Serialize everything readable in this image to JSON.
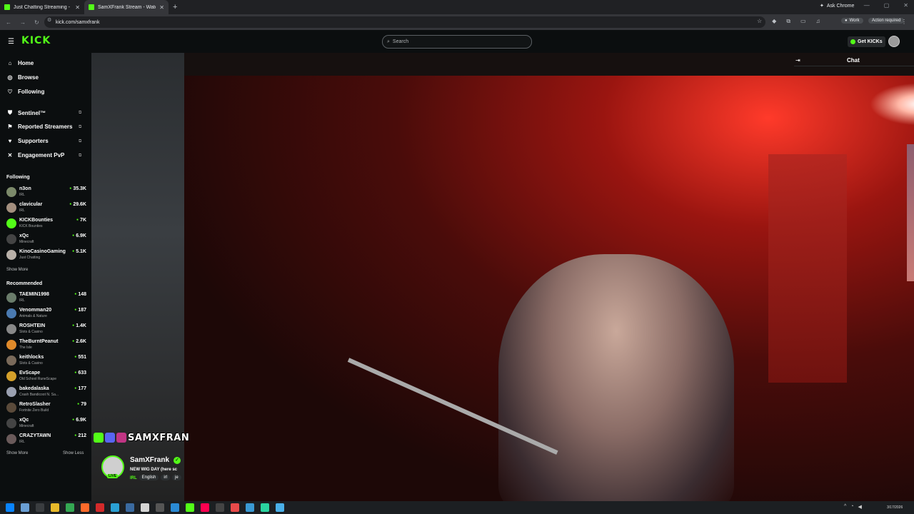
{
  "browser": {
    "tabs": [
      {
        "title": "Just Chatting Streaming - Live"
      },
      {
        "title": "SamXFrank Stream - Watch Liv"
      }
    ],
    "new_tab": "+",
    "ask_chrome": "Ask Chrome",
    "url": "kick.com/samxfrank",
    "profile_badge": "Work",
    "action_required": "Action required"
  },
  "kick": {
    "logo": "KICK",
    "search_placeholder": "Search",
    "get_kicks": "Get KICKs",
    "brand_color": "#53fc18"
  },
  "sidebar": {
    "nav": [
      {
        "label": "Home",
        "icon": "home-icon"
      },
      {
        "label": "Browse",
        "icon": "compass-icon"
      },
      {
        "label": "Following",
        "icon": "heart-icon"
      }
    ],
    "extras": [
      {
        "label": "Sentinel™",
        "icon": "shield-icon"
      },
      {
        "label": "Reported Streamers",
        "icon": "flag-icon"
      },
      {
        "label": "Supporters",
        "icon": "heart-icon"
      },
      {
        "label": "Engagement PvP",
        "icon": "swords-icon"
      }
    ],
    "following_title": "Following",
    "following": [
      {
        "name": "n3on",
        "category": "IRL",
        "viewers": "35.3K"
      },
      {
        "name": "clavicular",
        "category": "IRL",
        "viewers": "29.6K"
      },
      {
        "name": "KICKBounties",
        "category": "KICK Bounties",
        "viewers": "7K"
      },
      {
        "name": "xQc",
        "category": "Minecraft",
        "viewers": "6.9K"
      },
      {
        "name": "KinoCasinoGaming",
        "category": "Just Chatting",
        "viewers": "5.1K"
      }
    ],
    "show_more_1": "Show More",
    "recommended_title": "Recommended",
    "recommended": [
      {
        "name": "TAEMIN1998",
        "category": "IRL",
        "viewers": "148"
      },
      {
        "name": "Venomman20",
        "category": "Animals & Nature",
        "viewers": "187"
      },
      {
        "name": "ROSHTEIN",
        "category": "Slots & Casino",
        "viewers": "1.4K"
      },
      {
        "name": "TheBurntPeanut",
        "category": "The Isle",
        "viewers": "2.6K"
      },
      {
        "name": "keithlocks",
        "category": "Slots & Casino",
        "viewers": "551"
      },
      {
        "name": "EvScape",
        "category": "Old School RuneScape",
        "viewers": "633"
      },
      {
        "name": "bakedalaska",
        "category": "Crash Bandicoot N. Sa...",
        "viewers": "177"
      },
      {
        "name": "RetroSlasher",
        "category": "Fortnite Zero Build",
        "viewers": "79"
      },
      {
        "name": "xQc",
        "category": "Minecraft",
        "viewers": "6.9K"
      },
      {
        "name": "CRAZYTAWN",
        "category": "IRL",
        "viewers": "212"
      }
    ],
    "show_more_2": "Show More",
    "show_less": "Show Less"
  },
  "stream": {
    "overlay_text": "SAMXFRAN",
    "streamer": "SamXFrank",
    "live_badge": "LIVE",
    "title": "NEW WIG DAY (here sc",
    "category": "IRL",
    "tags": [
      "English",
      "irl",
      "je"
    ]
  },
  "chat": {
    "label": "Chat"
  },
  "taskbar": {
    "clock": "3/17/2026"
  }
}
